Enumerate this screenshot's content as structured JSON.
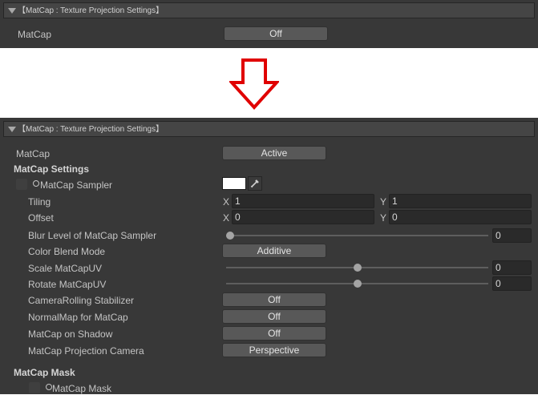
{
  "top": {
    "header": "【MatCap : Texture Projection Settings】",
    "matcap_label": "MatCap",
    "matcap_value": "Off"
  },
  "bottom": {
    "header": "【MatCap : Texture Projection Settings】",
    "matcap_label": "MatCap",
    "matcap_value": "Active",
    "settings_heading": "MatCap Settings",
    "sampler_label": "MatCap Sampler",
    "sampler_color": "#ffffff",
    "tiling_label": "Tiling",
    "tiling_x_axis": "X",
    "tiling_x": "1",
    "tiling_y_axis": "Y",
    "tiling_y": "1",
    "offset_label": "Offset",
    "offset_x_axis": "X",
    "offset_x": "0",
    "offset_y_axis": "Y",
    "offset_y": "0",
    "blur_label": "Blur Level of MatCap Sampler",
    "blur_value": "0",
    "blur_fraction": 0.0,
    "blend_label": "Color Blend Mode",
    "blend_value": "Additive",
    "scale_label": "Scale MatCapUV",
    "scale_value": "0",
    "scale_fraction": 0.5,
    "rotate_label": "Rotate MatCapUV",
    "rotate_value": "0",
    "rotate_fraction": 0.5,
    "camrolling_label": "CameraRolling Stabilizer",
    "camrolling_value": "Off",
    "normalmap_label": "NormalMap for MatCap",
    "normalmap_value": "Off",
    "shadow_label": "MatCap on Shadow",
    "shadow_value": "Off",
    "projection_label": "MatCap Projection Camera",
    "projection_value": "Perspective",
    "mask_heading": "MatCap Mask",
    "mask_label": "MatCap Mask"
  },
  "arrow_color": "#e00000"
}
